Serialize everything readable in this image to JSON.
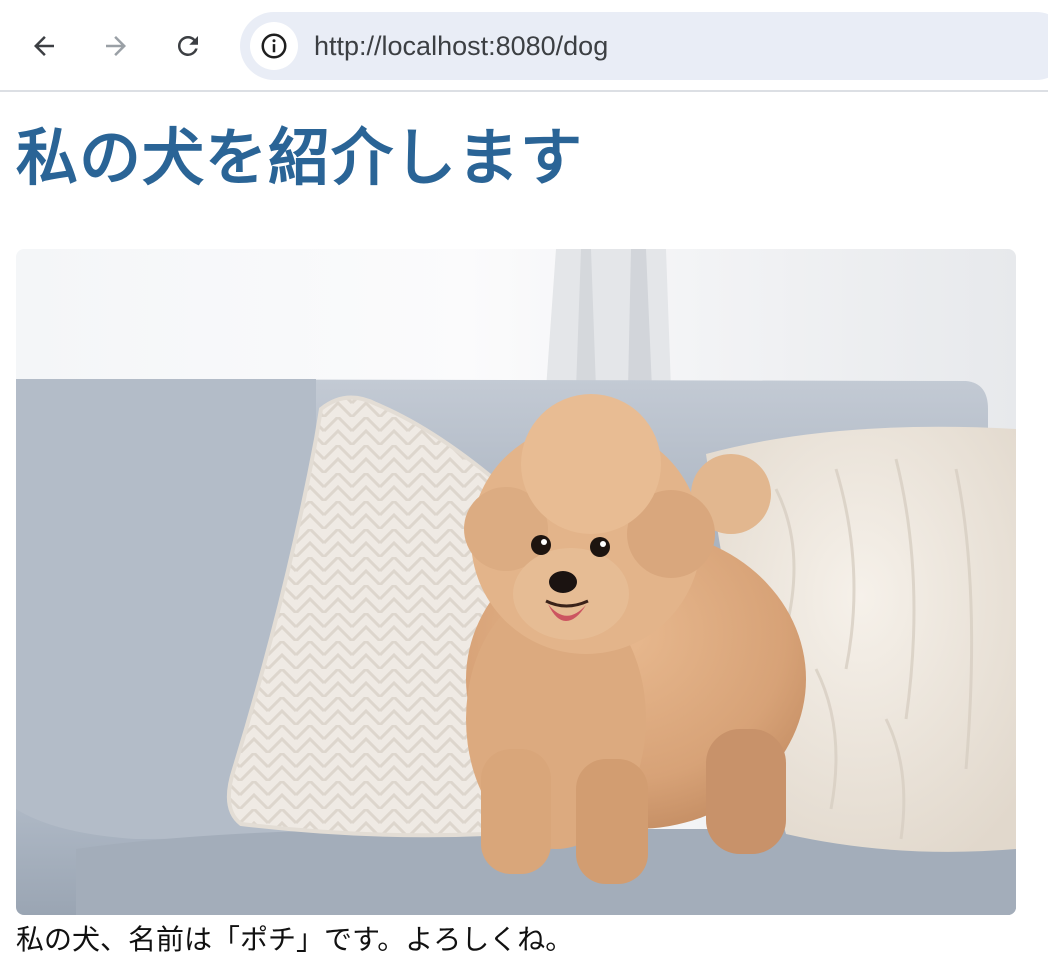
{
  "browser": {
    "url": "http://localhost:8080/dog",
    "icons": {
      "back": "back-arrow-icon",
      "forward": "forward-arrow-icon",
      "reload": "reload-icon",
      "site_info": "info-icon"
    },
    "forward_enabled": false
  },
  "page": {
    "title": "私の犬を紹介します",
    "caption": "私の犬、名前は「ポチ」です。よろしくね。",
    "accent_color": "#2a6496"
  }
}
